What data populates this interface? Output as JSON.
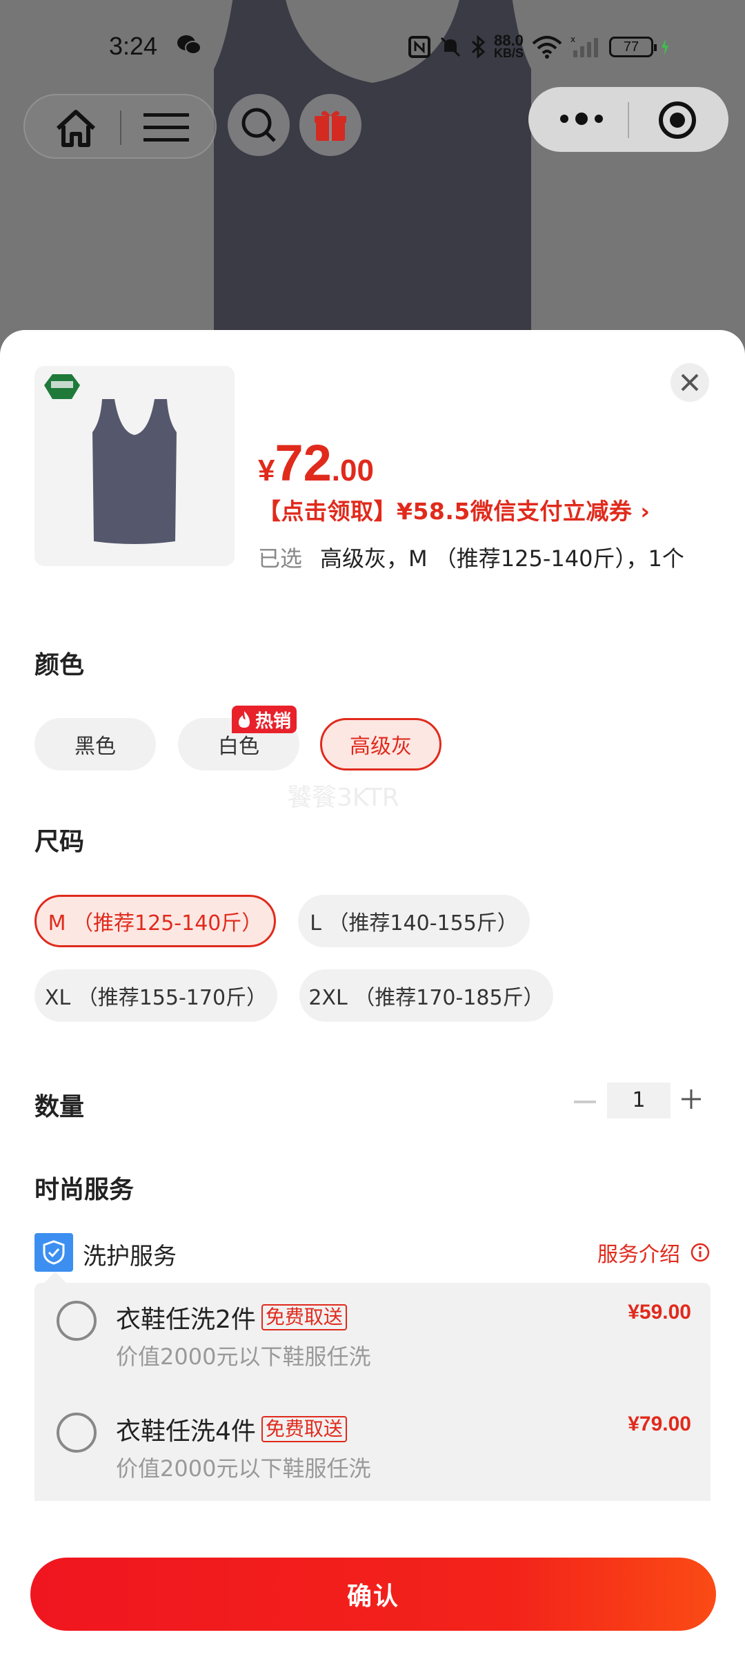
{
  "status_bar": {
    "time": "3:24",
    "net_speed": "88.0",
    "net_unit": "KB/S",
    "battery": "77"
  },
  "product": {
    "price_currency": "¥",
    "price_int": "72",
    "price_dec": ".00",
    "coupon": "【点击领取】¥58.5微信支付立减券 ›",
    "selected_label": "已选",
    "selected_value": "高级灰，M （推荐125-140斤），1个"
  },
  "color_section": {
    "title": "颜色",
    "options": [
      {
        "label": "黑色",
        "selected": false
      },
      {
        "label": "白色",
        "selected": false
      },
      {
        "label": "高级灰",
        "selected": true
      }
    ],
    "hot_tag": "热销"
  },
  "watermark": "饕餮3KTR",
  "size_section": {
    "title": "尺码",
    "options": [
      {
        "label": "M （推荐125-140斤）",
        "selected": true
      },
      {
        "label": "L （推荐140-155斤）",
        "selected": false
      },
      {
        "label": "XL （推荐155-170斤）",
        "selected": false
      },
      {
        "label": "2XL （推荐170-185斤）",
        "selected": false
      }
    ]
  },
  "quantity": {
    "title": "数量",
    "value": "1"
  },
  "service": {
    "section_title": "时尚服务",
    "group_title": "洗护服务",
    "intro_link": "服务介绍",
    "items": [
      {
        "name": "衣鞋任洗2件",
        "tag": "免费取送",
        "desc": "价值2000元以下鞋服任洗",
        "price": "¥59.00"
      },
      {
        "name": "衣鞋任洗4件",
        "tag": "免费取送",
        "desc": "价值2000元以下鞋服任洗",
        "price": "¥79.00"
      }
    ]
  },
  "confirm_label": "确认",
  "colors": {
    "accent": "#e02a1c",
    "shield_blue": "#3c8ff0"
  }
}
